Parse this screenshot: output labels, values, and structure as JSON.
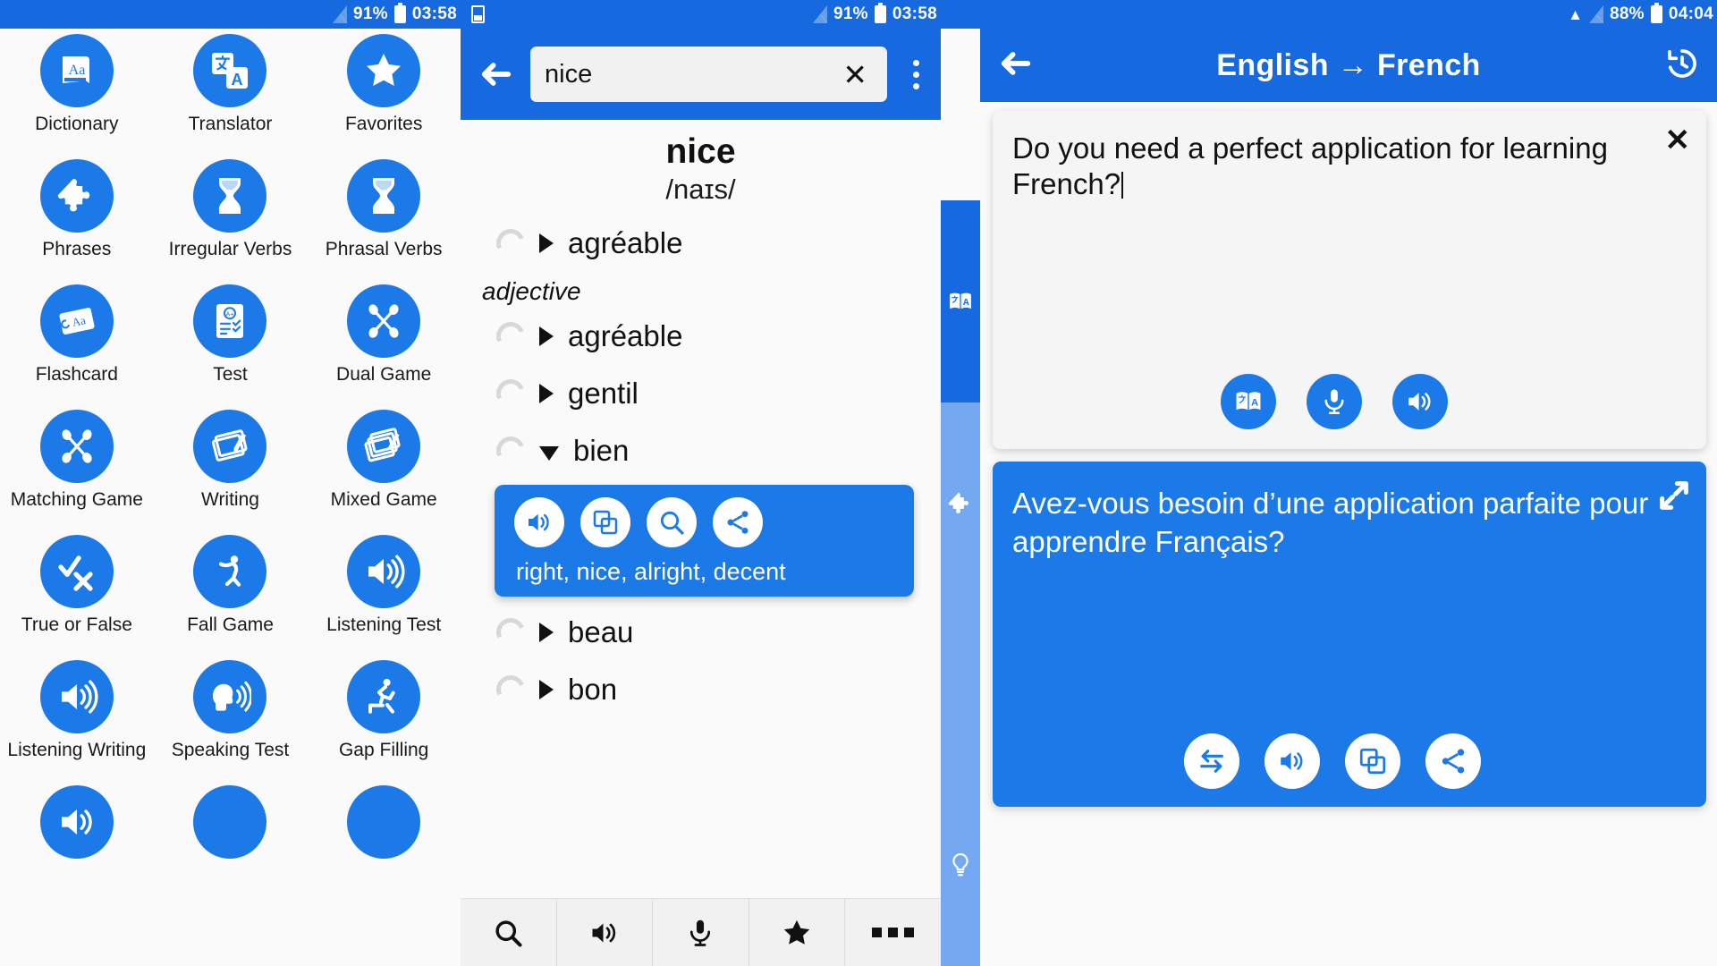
{
  "status_bar": {
    "segments": [
      {
        "battery": "91%",
        "time": "03:58",
        "has_wifi": false,
        "has_app_icon": true
      },
      {
        "battery": "91%",
        "time": "03:58",
        "has_wifi": false,
        "has_app_icon": false
      },
      {
        "battery": "88%",
        "time": "04:04",
        "has_wifi": true,
        "has_app_icon": false
      }
    ]
  },
  "left_panel": {
    "tiles": [
      {
        "label": "Dictionary",
        "icon": "book-aa-icon"
      },
      {
        "label": "Translator",
        "icon": "translate-icon"
      },
      {
        "label": "Favorites",
        "icon": "star-icon"
      },
      {
        "label": "Phrases",
        "icon": "puzzle-icon"
      },
      {
        "label": "Irregular Verbs",
        "icon": "hourglass-icon"
      },
      {
        "label": "Phrasal Verbs",
        "icon": "hourglass-icon"
      },
      {
        "label": "Flashcard",
        "icon": "flashcard-aa-icon"
      },
      {
        "label": "Test",
        "icon": "test-paper-icon"
      },
      {
        "label": "Dual Game",
        "icon": "dual-game-icon"
      },
      {
        "label": "Matching Game",
        "icon": "matching-game-icon"
      },
      {
        "label": "Writing",
        "icon": "writing-pen-icon"
      },
      {
        "label": "Mixed Game",
        "icon": "mixed-cards-icon"
      },
      {
        "label": "True or False",
        "icon": "check-cross-icon"
      },
      {
        "label": "Fall Game",
        "icon": "falling-person-icon"
      },
      {
        "label": "Listening Test",
        "icon": "speaker-icon"
      },
      {
        "label": "Listening Writing",
        "icon": "speaker-icon"
      },
      {
        "label": "Speaking Test",
        "icon": "speaking-head-icon"
      },
      {
        "label": "Gap Filling",
        "icon": "running-person-icon"
      },
      {
        "label": "",
        "icon": "speaker-icon"
      },
      {
        "label": "",
        "icon": "blank-icon"
      },
      {
        "label": "",
        "icon": "blank-icon"
      }
    ]
  },
  "middle_panel": {
    "search": {
      "value": "nice",
      "placeholder": "Search",
      "clear_label": "✕"
    },
    "entry": {
      "word": "nice",
      "ipa": "/naɪs/"
    },
    "definitions": [
      {
        "text": "agréable",
        "expanded": false,
        "section": null
      },
      {
        "text": "agréable",
        "expanded": false,
        "section": "adjective"
      },
      {
        "text": "gentil",
        "expanded": false,
        "section": null
      },
      {
        "text": "bien",
        "expanded": true,
        "section": null
      },
      {
        "text": "beau",
        "expanded": false,
        "section": null
      },
      {
        "text": "bon",
        "expanded": false,
        "section": null
      }
    ],
    "action_card": {
      "synonyms": "right, nice, alright, decent",
      "buttons": [
        "speaker-icon",
        "copy-icon",
        "search-icon",
        "share-icon"
      ]
    },
    "bottom_bar": [
      "search-icon",
      "speaker-icon",
      "microphone-icon",
      "star-icon",
      "more-icon"
    ]
  },
  "rail": {
    "items": [
      {
        "icon": "translate-icon",
        "active": true
      },
      {
        "icon": "puzzle-icon",
        "active": false
      },
      {
        "icon": "bulb-icon",
        "active": false
      }
    ]
  },
  "right_panel": {
    "title": "English → French",
    "back_icon": "back-arrow-icon",
    "history_icon": "history-icon",
    "source": {
      "text": "Do you need a perfect application for learning French?",
      "close_label": "✕",
      "buttons": [
        "translate-icon",
        "microphone-icon",
        "speaker-icon"
      ]
    },
    "output": {
      "text": "Avez-vous besoin d’une application parfaite pour apprendre Français?",
      "expand_icon": "expand-icon",
      "buttons": [
        "swap-icon",
        "speaker-icon",
        "copy-icon",
        "share-icon"
      ]
    }
  },
  "colors": {
    "primary": "#1c7ae8",
    "appbar": "#1769e0",
    "rail_dim": "#74a8f0",
    "page_bg": "#fafafa"
  }
}
